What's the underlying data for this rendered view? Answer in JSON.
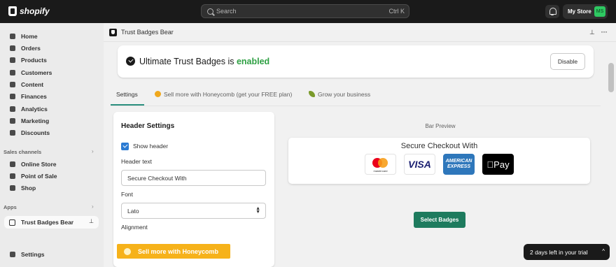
{
  "topbar": {
    "logo_text": "shopify",
    "search_placeholder": "Search",
    "search_shortcut": "Ctrl K",
    "store_name": "My Store",
    "store_initials": "MS"
  },
  "sidebar": {
    "items": [
      {
        "label": "Home",
        "icon": "home-icon"
      },
      {
        "label": "Orders",
        "icon": "orders-icon"
      },
      {
        "label": "Products",
        "icon": "products-icon"
      },
      {
        "label": "Customers",
        "icon": "customers-icon"
      },
      {
        "label": "Content",
        "icon": "content-icon"
      },
      {
        "label": "Finances",
        "icon": "finances-icon"
      },
      {
        "label": "Analytics",
        "icon": "analytics-icon"
      },
      {
        "label": "Marketing",
        "icon": "marketing-icon"
      },
      {
        "label": "Discounts",
        "icon": "discounts-icon"
      }
    ],
    "sales_channels_label": "Sales channels",
    "channels": [
      {
        "label": "Online Store",
        "icon": "online-store-icon"
      },
      {
        "label": "Point of Sale",
        "icon": "pos-icon"
      },
      {
        "label": "Shop",
        "icon": "shop-icon"
      }
    ],
    "apps_label": "Apps",
    "active_app": "Trust Badges Bear",
    "settings_label": "Settings"
  },
  "app_header": {
    "title": "Trust Badges Bear",
    "more": "···"
  },
  "banner": {
    "text_prefix": "Ultimate Trust Badges is ",
    "status": "enabled",
    "button": "Disable",
    "status_color": "#2ea043"
  },
  "tabs": [
    {
      "label": "Settings",
      "active": true
    },
    {
      "label": "Sell more with Honeycomb (get your FREE plan)",
      "active": false
    },
    {
      "label": "Grow your business",
      "active": false
    }
  ],
  "header_settings": {
    "title": "Header Settings",
    "show_header_label": "Show header",
    "show_header_checked": true,
    "header_text_label": "Header text",
    "header_text_value": "Secure Checkout With",
    "font_label": "Font",
    "font_value": "Lato",
    "alignment_label": "Alignment"
  },
  "preview": {
    "label": "Bar Preview",
    "bar_title": "Secure Checkout With",
    "badges": [
      {
        "name": "mastercard",
        "text": "mastercard"
      },
      {
        "name": "visa",
        "text": "VISA"
      },
      {
        "name": "american-express",
        "text": "AMERICAN EXPRESS"
      },
      {
        "name": "apple-pay",
        "text": "Pay"
      }
    ],
    "select_button": "Select Badges",
    "accent_color": "#1e7b5e"
  },
  "footer": {
    "honeycomb_button": "Sell more with Honeycomb",
    "trial_text": "2 days left in your trial"
  }
}
